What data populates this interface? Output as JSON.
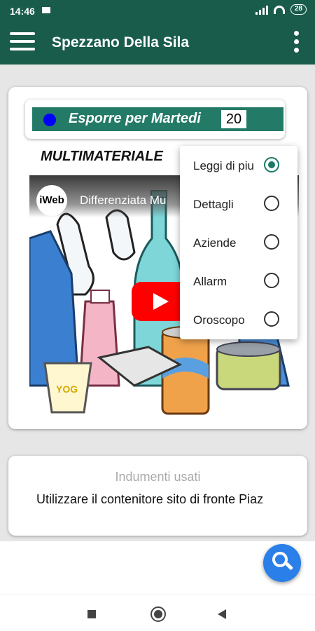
{
  "status_bar": {
    "time": "14:46",
    "battery": "28"
  },
  "app_bar": {
    "title": "Spezzano Della Sila"
  },
  "banner": {
    "text": "Esporre per Martedi",
    "day": "20",
    "dot_color": "#0000ff"
  },
  "section": {
    "title": "MULTIMATERIALE"
  },
  "video": {
    "title": "Differenziata Mu",
    "channel_logo": "iWeb"
  },
  "popup_menu": {
    "items": [
      {
        "label": "Leggi di piu",
        "selected": true
      },
      {
        "label": "Dettagli",
        "selected": false
      },
      {
        "label": "Aziende",
        "selected": false
      },
      {
        "label": "Allarm",
        "selected": false
      },
      {
        "label": "Oroscopo",
        "selected": false
      }
    ]
  },
  "info_card": {
    "title": "Indumenti usati",
    "text": "Utilizzare il contenitore sito di fronte Piaz"
  },
  "colors": {
    "primary_dark": "#1a5c4c",
    "banner_green": "#237a66",
    "fab_blue": "#2a7fe8",
    "radio_accent": "#1a7a66"
  }
}
